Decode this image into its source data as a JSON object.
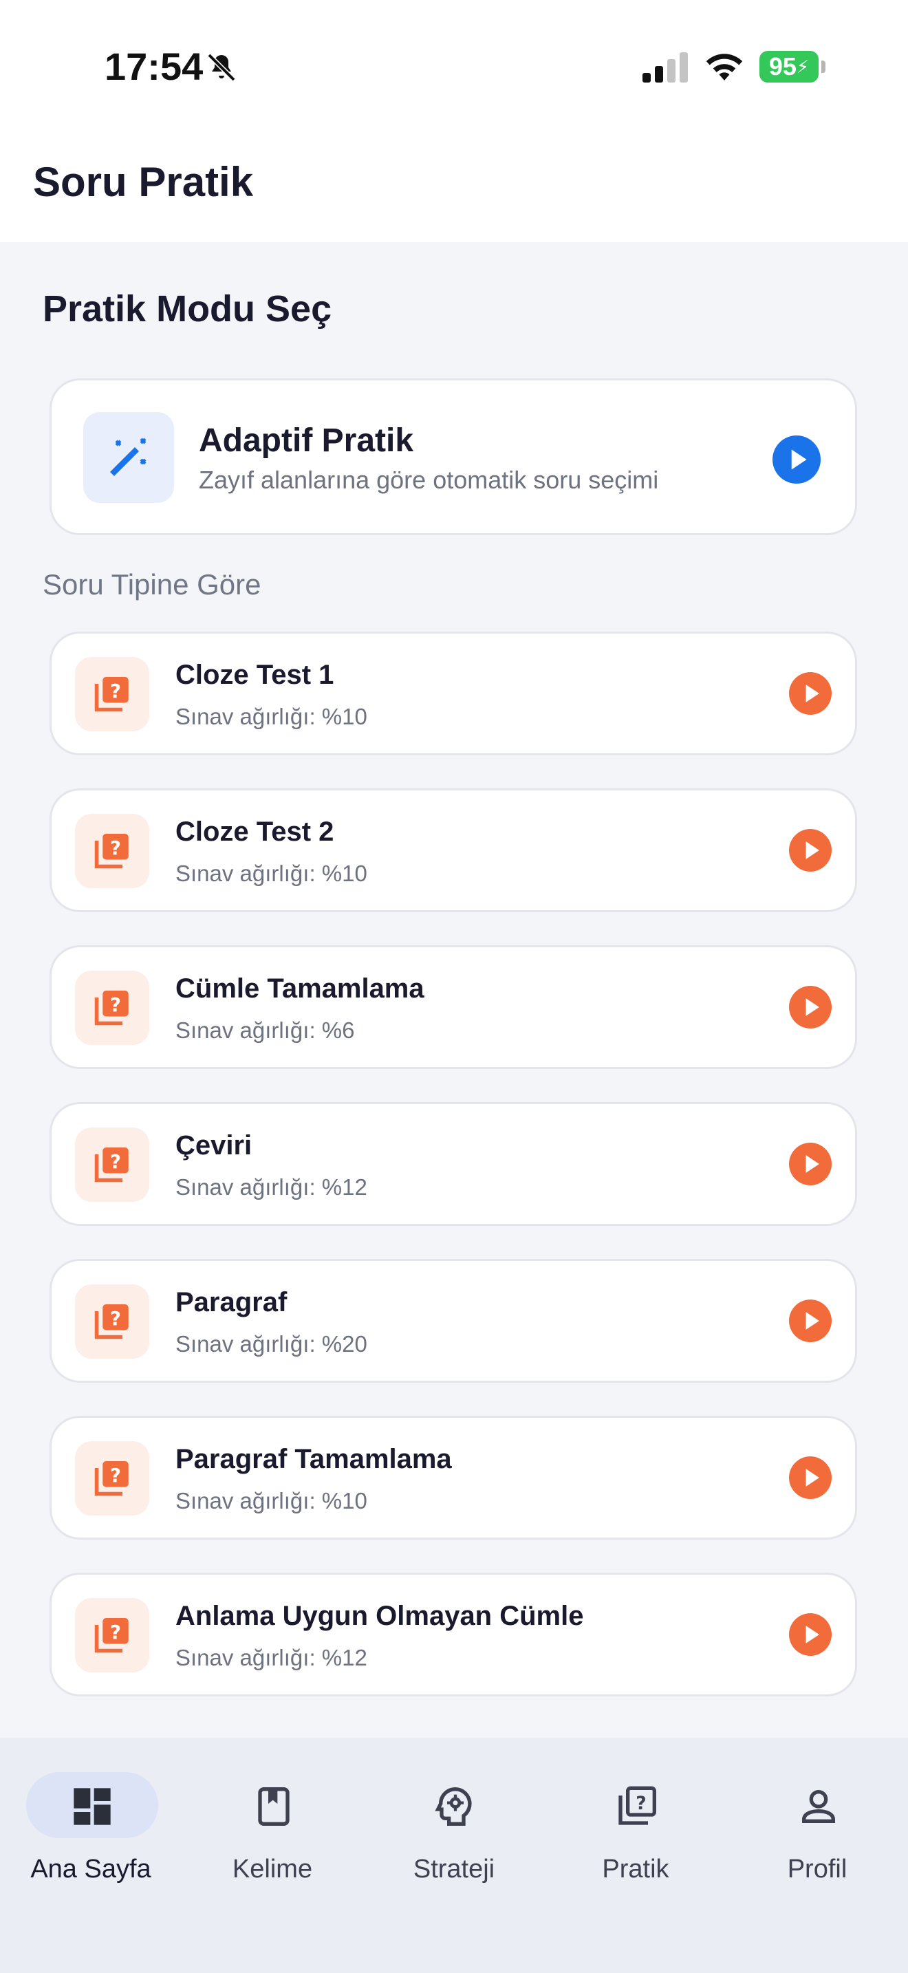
{
  "status_bar": {
    "time": "17:54",
    "battery": "95"
  },
  "header": {
    "title": "Soru Pratik"
  },
  "section_title": "Pratik Modu Seç",
  "adaptive": {
    "title": "Adaptif Pratik",
    "description": "Zayıf alanlarına göre otomatik soru seçimi",
    "icon": "magic-wand-icon",
    "accent": "#1a73e8"
  },
  "subsection_title": "Soru Tipine Göre",
  "practice_items": [
    {
      "title": "Cloze Test 1",
      "subtitle": "Sınav ağırlığı: %10"
    },
    {
      "title": "Cloze Test 2",
      "subtitle": "Sınav ağırlığı: %10"
    },
    {
      "title": "Cümle Tamamlama",
      "subtitle": "Sınav ağırlığı: %6"
    },
    {
      "title": "Çeviri",
      "subtitle": "Sınav ağırlığı: %12"
    },
    {
      "title": "Paragraf",
      "subtitle": "Sınav ağırlığı: %20"
    },
    {
      "title": "Paragraf Tamamlama",
      "subtitle": "Sınav ağırlığı: %10"
    },
    {
      "title": "Anlama Uygun Olmayan Cümle",
      "subtitle": "Sınav ağırlığı: %12"
    }
  ],
  "item_accent": "#f26b3a",
  "bottom_nav": {
    "items": [
      {
        "label": "Ana Sayfa",
        "icon": "dashboard-icon",
        "active": true
      },
      {
        "label": "Kelime",
        "icon": "book-icon",
        "active": false
      },
      {
        "label": "Strateji",
        "icon": "brain-icon",
        "active": false
      },
      {
        "label": "Pratik",
        "icon": "quiz-icon",
        "active": false
      },
      {
        "label": "Profil",
        "icon": "person-icon",
        "active": false
      }
    ]
  }
}
